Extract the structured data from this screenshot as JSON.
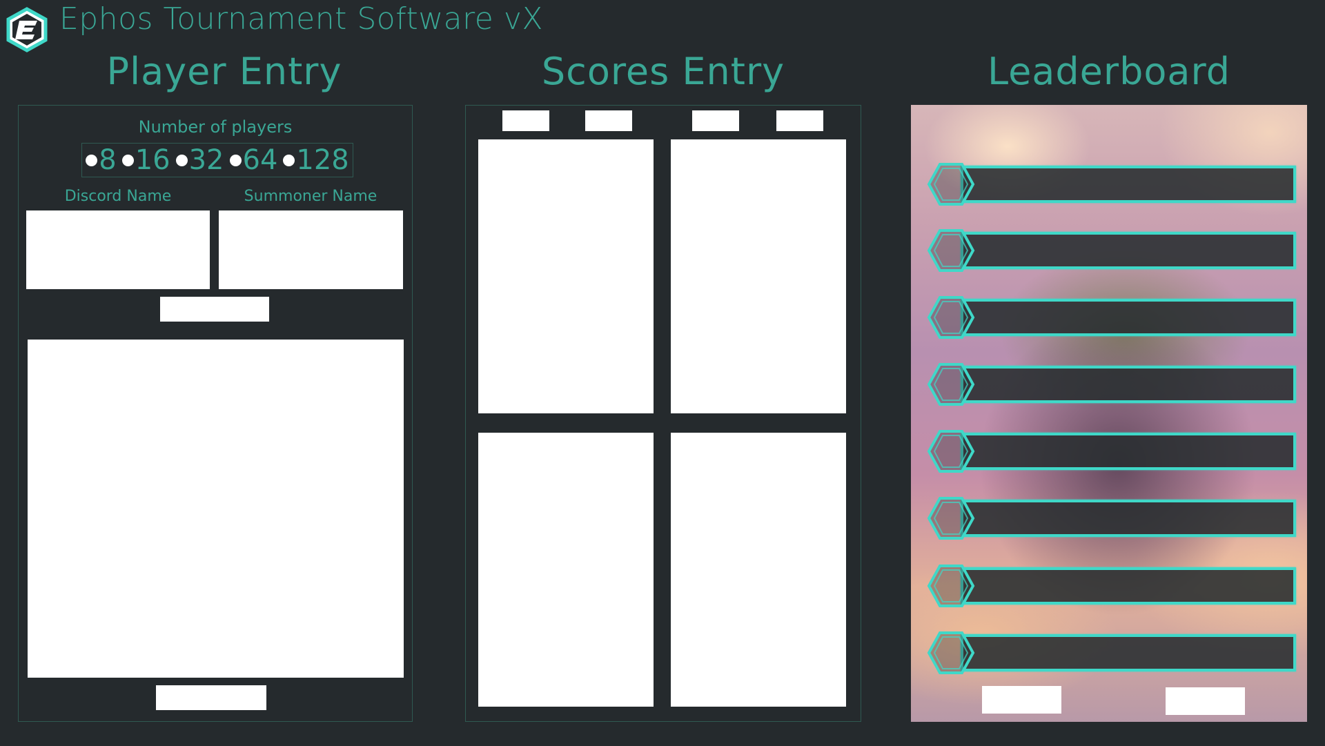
{
  "app": {
    "title": "Ephos Tournament Software vX",
    "logo_icon": "ephos-e-logo-icon",
    "accent_color": "#3aa795",
    "highlight_color": "#3fd8c8",
    "background_color": "#252a2d"
  },
  "player_entry": {
    "title": "Player Entry",
    "number_of_players_label": "Number of players",
    "player_count_options": [
      "8",
      "16",
      "32",
      "64",
      "128"
    ],
    "discord_name_label": "Discord Name",
    "summoner_name_label": "Summoner Name",
    "discord_name_value": "",
    "summoner_name_value": "",
    "player_list": ""
  },
  "scores_entry": {
    "title": "Scores Entry"
  },
  "leaderboard": {
    "title": "Leaderboard",
    "entries": [
      "",
      "",
      "",
      "",
      "",
      "",
      "",
      ""
    ]
  }
}
